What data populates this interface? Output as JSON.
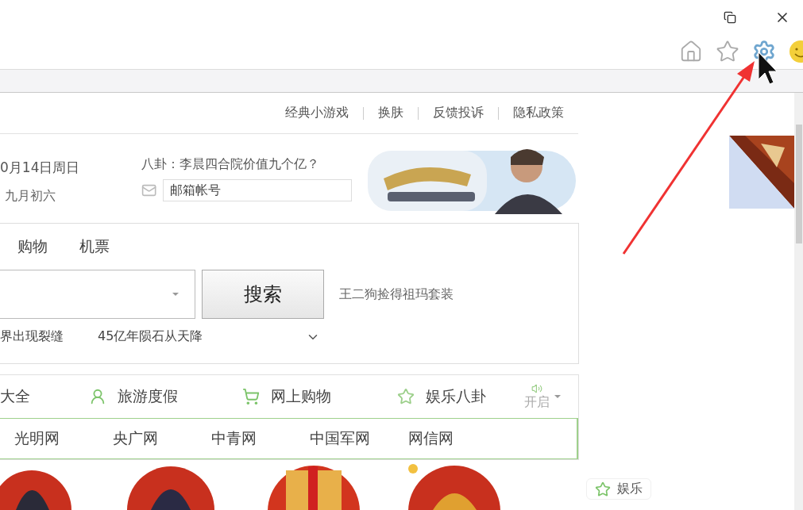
{
  "top_links": [
    "经典小游戏",
    "换肤",
    "反馈投诉",
    "隐私政策"
  ],
  "date": {
    "day": "0月14日周日",
    "lunar": "九月初六"
  },
  "headline": "八卦：李晨四合院价值九个亿？",
  "mail": {
    "placeholder": "邮箱帐号"
  },
  "search": {
    "tabs": [
      {
        "label": "购物",
        "selected": false
      },
      {
        "label": "机票",
        "selected": false
      }
    ],
    "button": "搜索",
    "hot": "王二狗捡得祖玛套装",
    "trending": [
      "界出现裂缝",
      "45亿年陨石从天降"
    ]
  },
  "categories": [
    {
      "kind": "plain",
      "label": "大全"
    },
    {
      "kind": "person",
      "label": "旅游度假"
    },
    {
      "kind": "cart",
      "label": "网上购物"
    },
    {
      "kind": "star",
      "label": "娱乐八卦"
    }
  ],
  "sound": {
    "label": "开启"
  },
  "sites": [
    "光明网",
    "央广网",
    "中青网",
    "中国军网",
    "网信网"
  ],
  "float_button": "娱乐"
}
